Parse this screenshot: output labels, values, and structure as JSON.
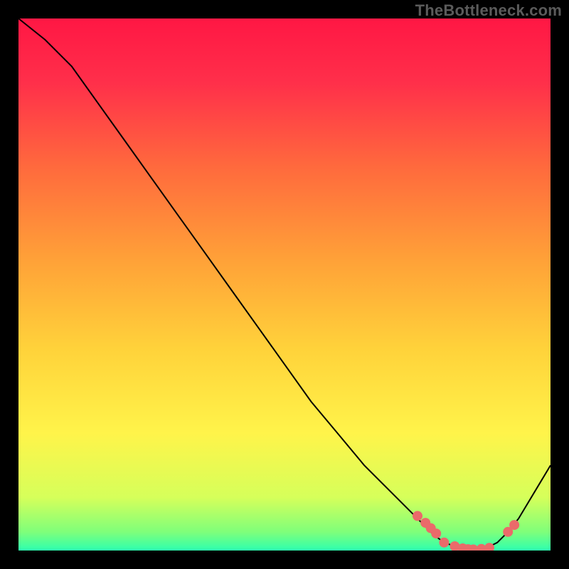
{
  "watermark": "TheBottleneck.com",
  "chart_data": {
    "type": "line",
    "title": "",
    "xlabel": "",
    "ylabel": "",
    "xlim": [
      0,
      100
    ],
    "ylim": [
      0,
      100
    ],
    "series": [
      {
        "name": "curve",
        "x": [
          0,
          5,
          10,
          15,
          20,
          25,
          30,
          35,
          40,
          45,
          50,
          55,
          60,
          65,
          70,
          75,
          78,
          80,
          82,
          85,
          88,
          90,
          92,
          94,
          100
        ],
        "y": [
          100,
          96,
          91,
          84,
          77,
          70,
          63,
          56,
          49,
          42,
          35,
          28,
          22,
          16,
          11,
          6,
          3,
          1.5,
          0.8,
          0.2,
          0.5,
          1.5,
          3.5,
          6,
          16
        ]
      }
    ],
    "markers": {
      "name": "dots",
      "x": [
        75,
        76.5,
        77.5,
        78.5,
        80,
        82,
        83.5,
        84.5,
        85.5,
        87,
        88.5,
        92,
        93.2
      ],
      "y": [
        6.5,
        5.2,
        4.2,
        3.2,
        1.5,
        0.8,
        0.4,
        0.25,
        0.2,
        0.3,
        0.5,
        3.5,
        4.8
      ]
    },
    "gradient_stops": [
      {
        "offset": 0.0,
        "color": "#ff1744"
      },
      {
        "offset": 0.12,
        "color": "#ff2f4a"
      },
      {
        "offset": 0.28,
        "color": "#ff6a3d"
      },
      {
        "offset": 0.45,
        "color": "#ffa038"
      },
      {
        "offset": 0.62,
        "color": "#ffd23a"
      },
      {
        "offset": 0.78,
        "color": "#fff44a"
      },
      {
        "offset": 0.9,
        "color": "#d6ff5a"
      },
      {
        "offset": 0.965,
        "color": "#7fff7a"
      },
      {
        "offset": 1.0,
        "color": "#2dffb0"
      }
    ],
    "marker_color": "#ea6a6a",
    "curve_color": "#000000"
  }
}
